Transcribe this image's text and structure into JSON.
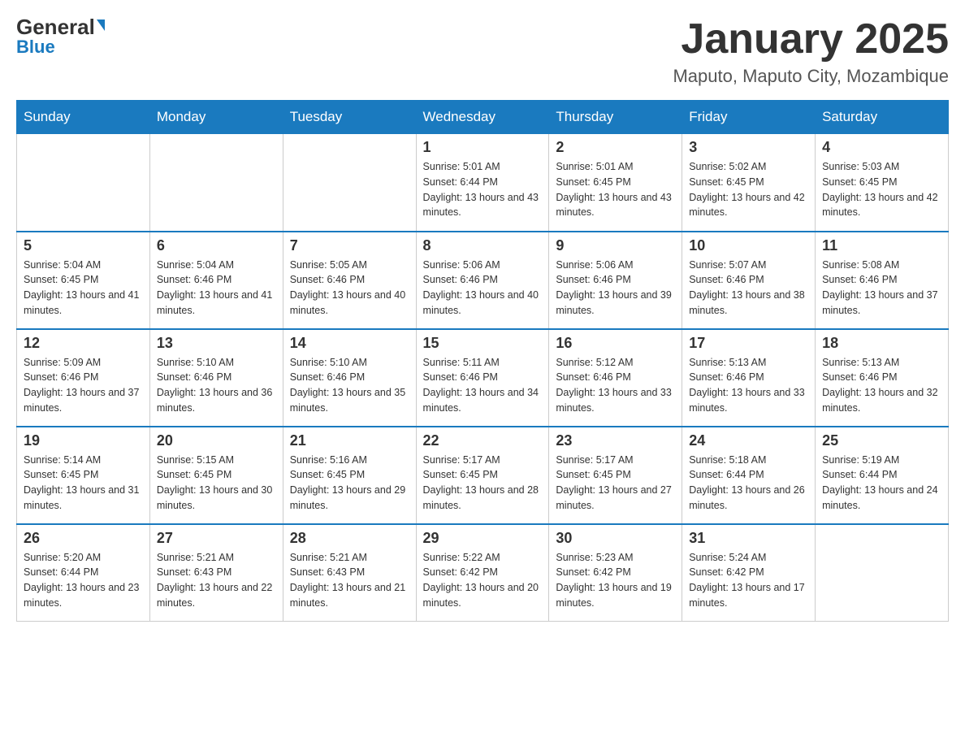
{
  "logo": {
    "part1": "General",
    "part2": "Blue"
  },
  "calendar": {
    "title": "January 2025",
    "subtitle": "Maputo, Maputo City, Mozambique",
    "days_of_week": [
      "Sunday",
      "Monday",
      "Tuesday",
      "Wednesday",
      "Thursday",
      "Friday",
      "Saturday"
    ],
    "weeks": [
      [
        {
          "day": "",
          "info": ""
        },
        {
          "day": "",
          "info": ""
        },
        {
          "day": "",
          "info": ""
        },
        {
          "day": "1",
          "info": "Sunrise: 5:01 AM\nSunset: 6:44 PM\nDaylight: 13 hours and 43 minutes."
        },
        {
          "day": "2",
          "info": "Sunrise: 5:01 AM\nSunset: 6:45 PM\nDaylight: 13 hours and 43 minutes."
        },
        {
          "day": "3",
          "info": "Sunrise: 5:02 AM\nSunset: 6:45 PM\nDaylight: 13 hours and 42 minutes."
        },
        {
          "day": "4",
          "info": "Sunrise: 5:03 AM\nSunset: 6:45 PM\nDaylight: 13 hours and 42 minutes."
        }
      ],
      [
        {
          "day": "5",
          "info": "Sunrise: 5:04 AM\nSunset: 6:45 PM\nDaylight: 13 hours and 41 minutes."
        },
        {
          "day": "6",
          "info": "Sunrise: 5:04 AM\nSunset: 6:46 PM\nDaylight: 13 hours and 41 minutes."
        },
        {
          "day": "7",
          "info": "Sunrise: 5:05 AM\nSunset: 6:46 PM\nDaylight: 13 hours and 40 minutes."
        },
        {
          "day": "8",
          "info": "Sunrise: 5:06 AM\nSunset: 6:46 PM\nDaylight: 13 hours and 40 minutes."
        },
        {
          "day": "9",
          "info": "Sunrise: 5:06 AM\nSunset: 6:46 PM\nDaylight: 13 hours and 39 minutes."
        },
        {
          "day": "10",
          "info": "Sunrise: 5:07 AM\nSunset: 6:46 PM\nDaylight: 13 hours and 38 minutes."
        },
        {
          "day": "11",
          "info": "Sunrise: 5:08 AM\nSunset: 6:46 PM\nDaylight: 13 hours and 37 minutes."
        }
      ],
      [
        {
          "day": "12",
          "info": "Sunrise: 5:09 AM\nSunset: 6:46 PM\nDaylight: 13 hours and 37 minutes."
        },
        {
          "day": "13",
          "info": "Sunrise: 5:10 AM\nSunset: 6:46 PM\nDaylight: 13 hours and 36 minutes."
        },
        {
          "day": "14",
          "info": "Sunrise: 5:10 AM\nSunset: 6:46 PM\nDaylight: 13 hours and 35 minutes."
        },
        {
          "day": "15",
          "info": "Sunrise: 5:11 AM\nSunset: 6:46 PM\nDaylight: 13 hours and 34 minutes."
        },
        {
          "day": "16",
          "info": "Sunrise: 5:12 AM\nSunset: 6:46 PM\nDaylight: 13 hours and 33 minutes."
        },
        {
          "day": "17",
          "info": "Sunrise: 5:13 AM\nSunset: 6:46 PM\nDaylight: 13 hours and 33 minutes."
        },
        {
          "day": "18",
          "info": "Sunrise: 5:13 AM\nSunset: 6:46 PM\nDaylight: 13 hours and 32 minutes."
        }
      ],
      [
        {
          "day": "19",
          "info": "Sunrise: 5:14 AM\nSunset: 6:45 PM\nDaylight: 13 hours and 31 minutes."
        },
        {
          "day": "20",
          "info": "Sunrise: 5:15 AM\nSunset: 6:45 PM\nDaylight: 13 hours and 30 minutes."
        },
        {
          "day": "21",
          "info": "Sunrise: 5:16 AM\nSunset: 6:45 PM\nDaylight: 13 hours and 29 minutes."
        },
        {
          "day": "22",
          "info": "Sunrise: 5:17 AM\nSunset: 6:45 PM\nDaylight: 13 hours and 28 minutes."
        },
        {
          "day": "23",
          "info": "Sunrise: 5:17 AM\nSunset: 6:45 PM\nDaylight: 13 hours and 27 minutes."
        },
        {
          "day": "24",
          "info": "Sunrise: 5:18 AM\nSunset: 6:44 PM\nDaylight: 13 hours and 26 minutes."
        },
        {
          "day": "25",
          "info": "Sunrise: 5:19 AM\nSunset: 6:44 PM\nDaylight: 13 hours and 24 minutes."
        }
      ],
      [
        {
          "day": "26",
          "info": "Sunrise: 5:20 AM\nSunset: 6:44 PM\nDaylight: 13 hours and 23 minutes."
        },
        {
          "day": "27",
          "info": "Sunrise: 5:21 AM\nSunset: 6:43 PM\nDaylight: 13 hours and 22 minutes."
        },
        {
          "day": "28",
          "info": "Sunrise: 5:21 AM\nSunset: 6:43 PM\nDaylight: 13 hours and 21 minutes."
        },
        {
          "day": "29",
          "info": "Sunrise: 5:22 AM\nSunset: 6:42 PM\nDaylight: 13 hours and 20 minutes."
        },
        {
          "day": "30",
          "info": "Sunrise: 5:23 AM\nSunset: 6:42 PM\nDaylight: 13 hours and 19 minutes."
        },
        {
          "day": "31",
          "info": "Sunrise: 5:24 AM\nSunset: 6:42 PM\nDaylight: 13 hours and 17 minutes."
        },
        {
          "day": "",
          "info": ""
        }
      ]
    ]
  }
}
